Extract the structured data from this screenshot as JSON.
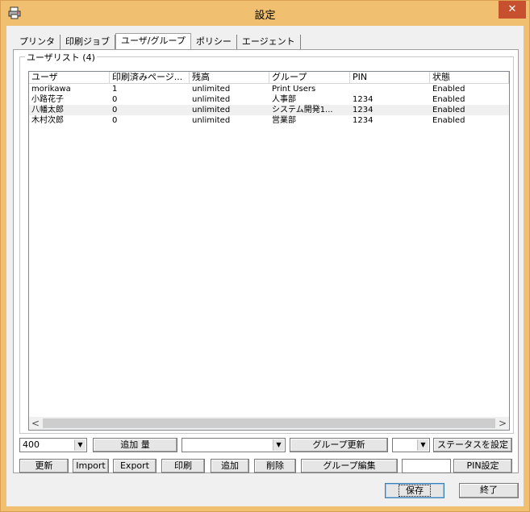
{
  "window": {
    "title": "設定",
    "close_glyph": "✕"
  },
  "tabs": [
    "プリンタ",
    "印刷ジョブ",
    "ユーザ/グループ",
    "ポリシー",
    "エージェント"
  ],
  "active_tab_index": 2,
  "userlist": {
    "group_title": "ユーザリスト (4)",
    "columns": [
      "ユーザ",
      "印刷済みページ...",
      "残高",
      "グループ",
      "PIN",
      "状態"
    ],
    "rows": [
      [
        "morikawa",
        "1",
        "unlimited",
        "Print Users",
        "",
        "Enabled"
      ],
      [
        "小路花子",
        "0",
        "unlimited",
        "人事部",
        "1234",
        "Enabled"
      ],
      [
        "八幡太郎",
        "0",
        "unlimited",
        "システム開発1...",
        "1234",
        "Enabled"
      ],
      [
        "木村次郎",
        "0",
        "unlimited",
        "営業部",
        "1234",
        "Enabled"
      ]
    ],
    "selected_row_index": 2
  },
  "scroll": {
    "left": "<",
    "right": ">"
  },
  "controls_row1": {
    "amount_value": "400",
    "add_amount_label": "追加 量",
    "group_combo_value": "",
    "group_update_label": "グループ更新",
    "status_combo_value": "",
    "set_status_label": "ステータスを設定"
  },
  "controls_row2": {
    "refresh_label": "更新",
    "import_label": "Import",
    "export_label": "Export",
    "print_label": "印刷",
    "add_label": "追加",
    "delete_label": "削除",
    "group_edit_label": "グループ編集",
    "pin_value": "",
    "pin_set_label": "PIN設定"
  },
  "footer": {
    "save_label": "保存",
    "end_label": "終了"
  },
  "colors": {
    "frame": "#f0c070",
    "close": "#c7502e",
    "selected_row": "#f0f0f0"
  }
}
